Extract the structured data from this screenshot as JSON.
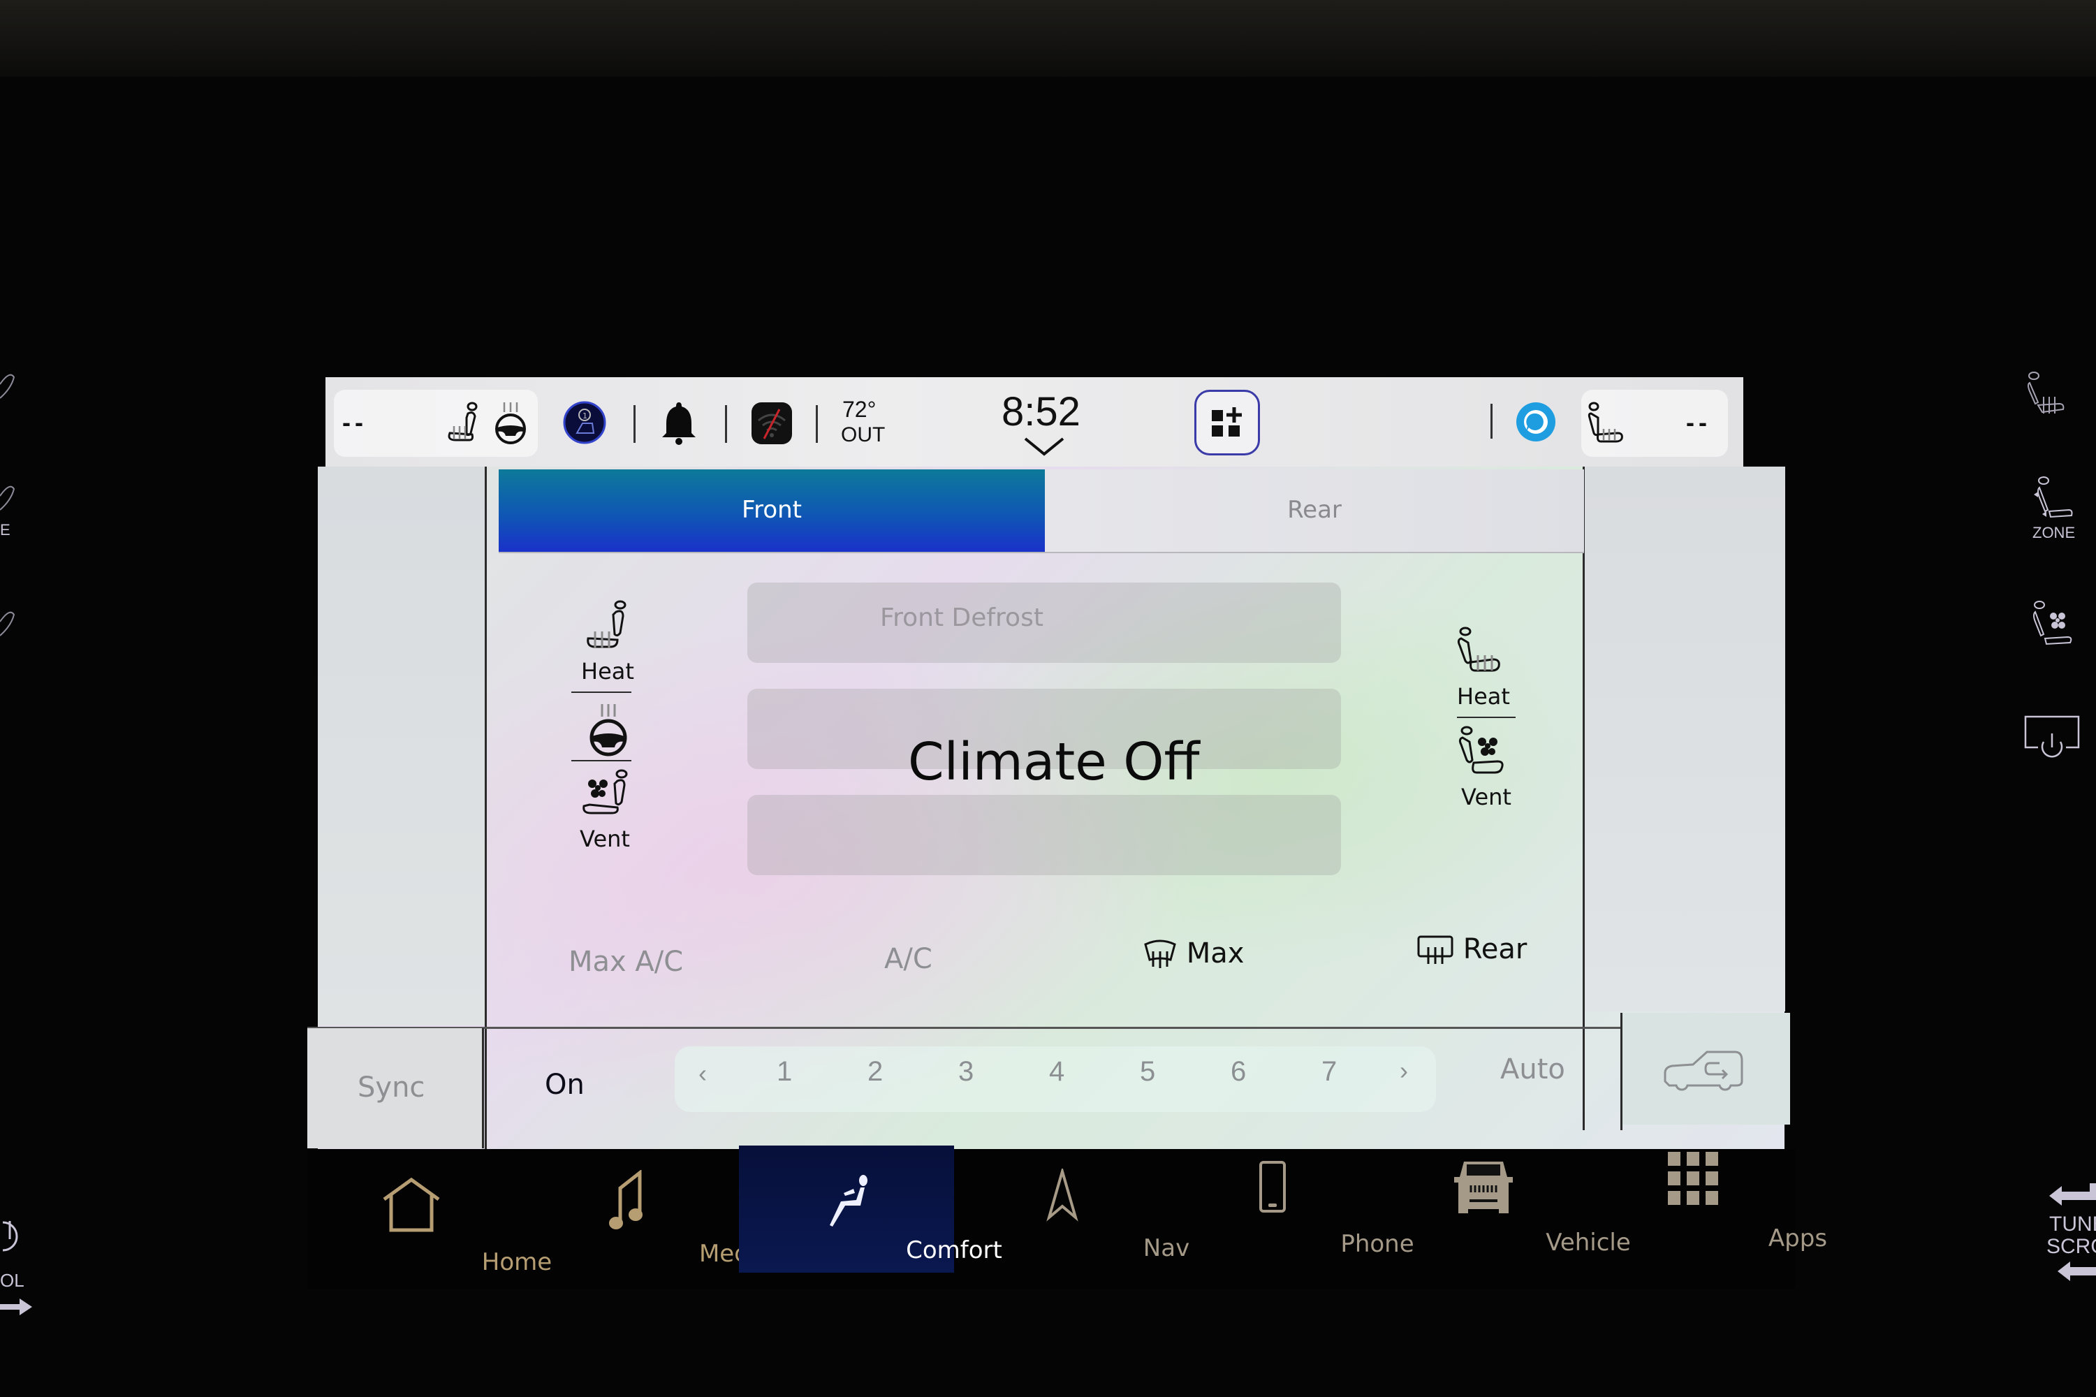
{
  "status_bar": {
    "driver_temp": "--",
    "driver_seat_heat_icon": "seat-heat-icon",
    "steering_heat_icon": "steering-wheel-heat-icon",
    "profile_icon": "driver-profile-icon",
    "notification_icon": "bell-icon",
    "wifi_icon": "wifi-off-icon",
    "outside_temp": "72°",
    "outside_label": "OUT",
    "time": "8:52",
    "time_expand_icon": "chevron-down-icon",
    "add_widget_icon": "add-widget-icon",
    "voice_assistant_icon": "alexa-icon",
    "passenger_seat_heat_icon": "seat-heat-icon",
    "passenger_temp": "--"
  },
  "zone_tabs": [
    {
      "label": "Front",
      "active": true
    },
    {
      "label": "Rear",
      "active": false
    }
  ],
  "driver_controls": {
    "seat_heat_label": "Heat",
    "steering_heat_icon": "steering-wheel-heat-icon",
    "seat_vent_label": "Vent"
  },
  "passenger_controls": {
    "seat_heat_label": "Heat",
    "seat_vent_label": "Vent"
  },
  "mode_buttons": [
    {
      "label": "Front Defrost",
      "enabled": false
    },
    {
      "label": "",
      "enabled": false
    },
    {
      "label": "",
      "enabled": false
    }
  ],
  "climate_status": "Climate Off",
  "function_row": [
    {
      "label": "Max A/C",
      "enabled": false
    },
    {
      "label": "A/C",
      "enabled": false
    },
    {
      "label": "Max",
      "icon": "max-defrost-icon",
      "enabled": true
    },
    {
      "label": "Rear",
      "icon": "rear-defrost-icon",
      "enabled": true
    }
  ],
  "fan_row": {
    "sync_label": "Sync",
    "power_label": "On",
    "prev_icon": "chevron-left-icon",
    "next_icon": "chevron-right-icon",
    "speeds": [
      "1",
      "2",
      "3",
      "4",
      "5",
      "6",
      "7"
    ],
    "auto_label": "Auto",
    "recirculation_icon": "recirculation-icon"
  },
  "nav_bar": [
    {
      "label": "Home",
      "icon": "home-icon",
      "active": false
    },
    {
      "label": "Media",
      "icon": "music-note-icon",
      "active": false
    },
    {
      "label": "Comfort",
      "icon": "seated-person-icon",
      "active": true
    },
    {
      "label": "Nav",
      "icon": "navigation-arrow-icon",
      "active": false
    },
    {
      "label": "Phone",
      "icon": "phone-icon",
      "active": false
    },
    {
      "label": "Vehicle",
      "icon": "vehicle-icon",
      "active": false
    },
    {
      "label": "Apps",
      "icon": "apps-grid-icon",
      "active": false
    }
  ],
  "physical_buttons": {
    "right": [
      {
        "label": "",
        "icon": "rear-seat-heat-icon"
      },
      {
        "label": "ZONE",
        "icon": "zone-seat-icon"
      },
      {
        "label": "",
        "icon": "rear-seat-vent-icon"
      },
      {
        "label": "",
        "icon": "screen-off-icon"
      }
    ],
    "tune_scroll_label_1": "TUNE",
    "tune_scroll_label_2": "SCROLL",
    "left_volume_label": "OL"
  },
  "colors": {
    "active_tab_start": "#0d7a9a",
    "active_tab_end": "#1a31c9",
    "nav_text": "#b79e72",
    "nav_active_bg": "#0a1850",
    "alexa_blue": "#1e9de0"
  }
}
